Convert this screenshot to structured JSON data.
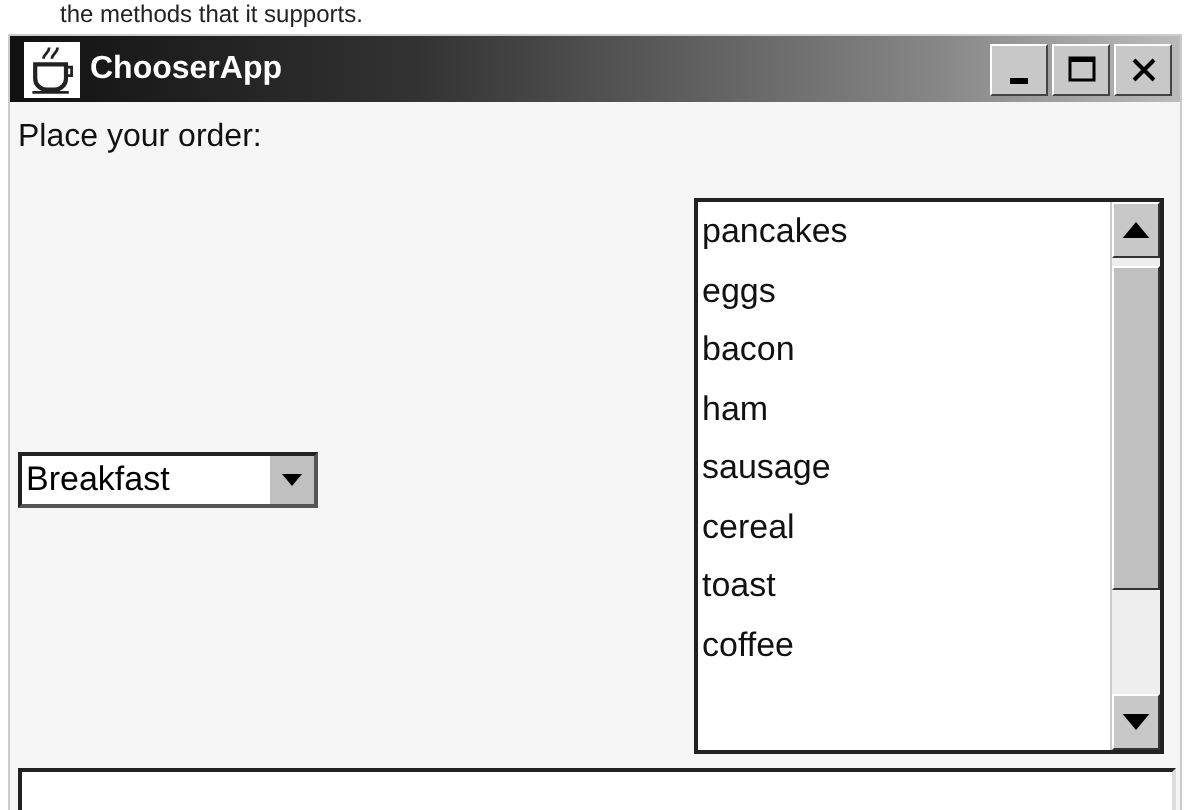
{
  "page_caption": "the methods that it supports.",
  "window": {
    "title": "ChooserApp"
  },
  "label": "Place your order:",
  "choice": {
    "value": "Breakfast"
  },
  "list": {
    "items": [
      {
        "text": "pancakes",
        "selected": false
      },
      {
        "text": "eggs",
        "selected": false
      },
      {
        "text": "bacon",
        "selected": false
      },
      {
        "text": "ham",
        "selected": false
      },
      {
        "text": "sausage",
        "selected": false
      },
      {
        "text": "cereal",
        "selected": false
      },
      {
        "text": "toast",
        "selected": false
      },
      {
        "text": "coffee",
        "selected": false
      }
    ]
  }
}
